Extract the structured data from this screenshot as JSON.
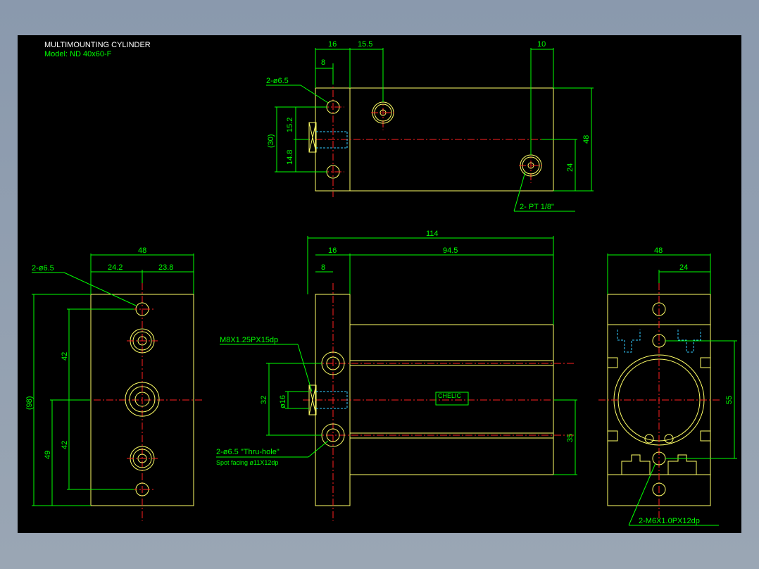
{
  "title": {
    "line1": "MULTIMOUNTING CYLINDER",
    "line2": "Model: ND 40x60-F"
  },
  "top_view": {
    "dim_16": "16",
    "dim_15_5": "15.5",
    "dim_10": "10",
    "dim_8": "8",
    "holes_label": "2-ø6.5",
    "dim_30": "(30)",
    "dim_15_2": "15.2",
    "dim_14_8": "14.8",
    "dim_48": "48",
    "dim_24": "24",
    "port_label": "2- PT 1/8\""
  },
  "left_view": {
    "dim_48": "48",
    "dim_24_2": "24.2",
    "dim_23_8": "23.8",
    "holes_label": "2-ø6.5",
    "dim_42a": "42",
    "dim_42b": "42",
    "dim_98": "(98)",
    "dim_49": "49"
  },
  "front_view": {
    "dim_114": "114",
    "dim_16": "16",
    "dim_94_5": "94.5",
    "dim_8": "8",
    "thread_label": "M8X1.25PX15dp",
    "dim_32": "32",
    "dim_16_dia": "ø16",
    "dim_35": "35",
    "holes_label": "2-ø6.5 \"Thru-hole\"",
    "spot_label": "Spot facing  ø11X12dp",
    "logo_text": "CHELIC"
  },
  "right_view": {
    "dim_48": "48",
    "dim_24": "24",
    "dim_55": "55",
    "thread_label": "2-M6X1.0PX12dp"
  },
  "colors": {
    "dimension": "#00ff00",
    "outline": "#ffff66",
    "center": "#ff2020",
    "hidden": "#33ccff",
    "background": "#000000"
  }
}
